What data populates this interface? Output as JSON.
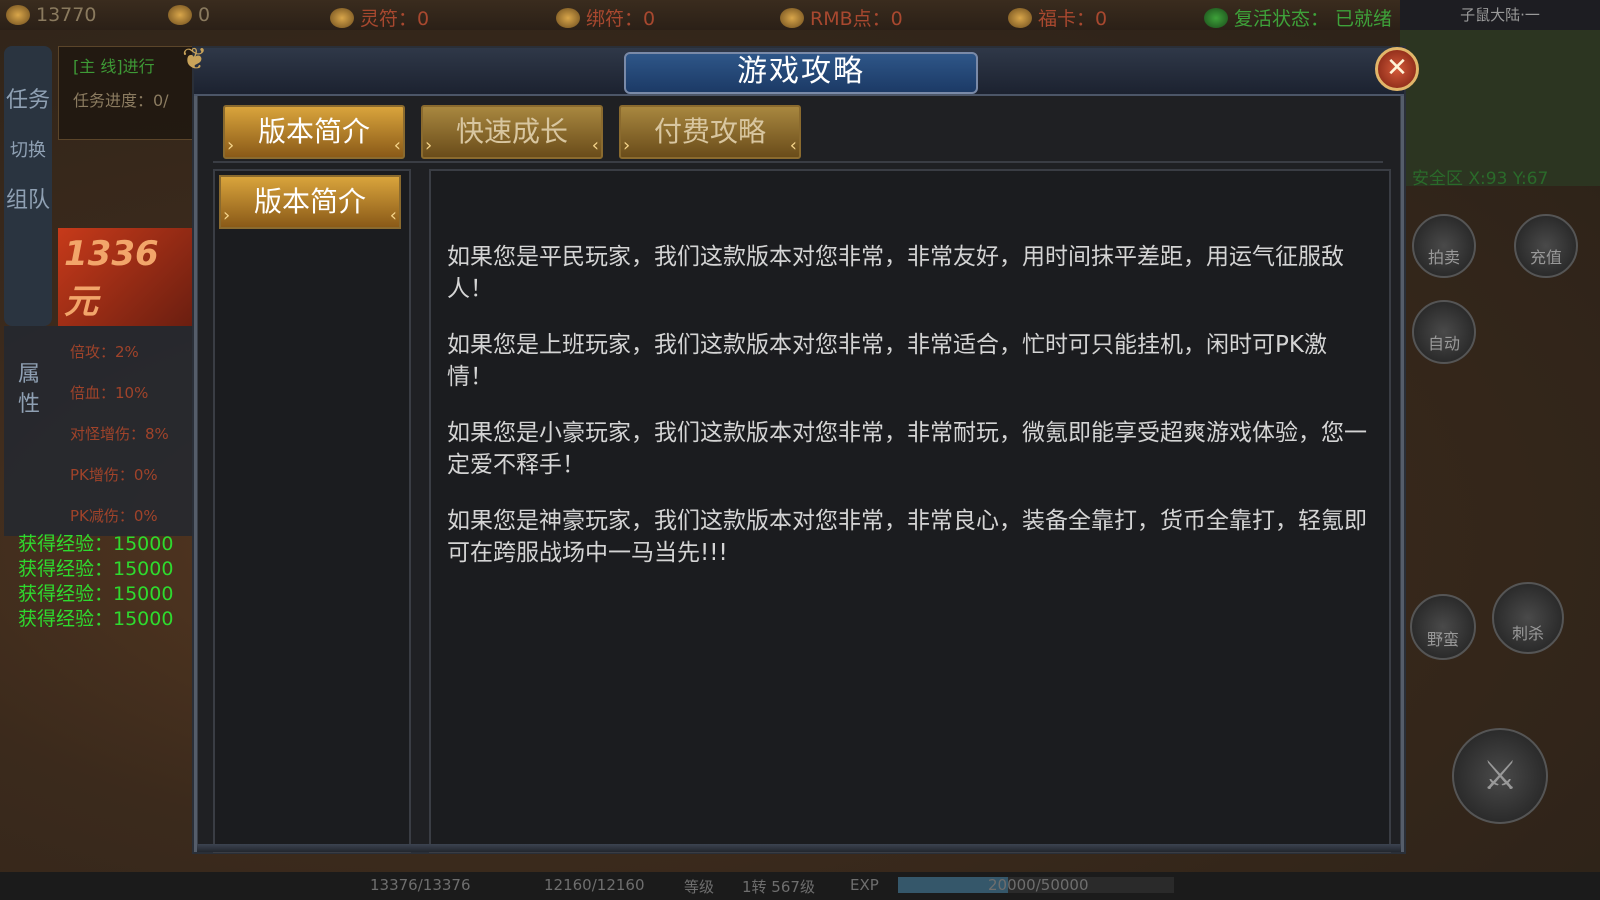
{
  "top_bar": {
    "gold": "13770",
    "ingot": "0",
    "lingfu": "灵符：0",
    "bangfu": "绑符：0",
    "rmb": "RMB点：0",
    "fuka": "福卡：0",
    "revive_label": "复活状态：",
    "revive_value": "已就绪",
    "map_name": "子鼠大陆·一"
  },
  "left_panel": {
    "tabs": [
      "任务",
      "切换",
      "组队"
    ],
    "quest_title": "[主 线]进行",
    "quest_progress": "任务进度：0/",
    "promo_text": "1336元",
    "attr_label": "属性",
    "attrs": [
      "倍攻：2%",
      "倍血：10%",
      "对怪增伤：8%",
      "PK增伤：0%",
      "PK减伤：0%"
    ],
    "exp_log": [
      "获得经验：15000",
      "获得经验：15000",
      "获得经验：15000",
      "获得经验：15000"
    ]
  },
  "right_panel": {
    "safe_zone": "安全区  X:93 Y:67",
    "skills": [
      "拍卖",
      "充值",
      "自动",
      "野蛮",
      "刺杀"
    ]
  },
  "bottom_bar": {
    "hp": "13376/13376",
    "mp": "12160/12160",
    "level_label": "等级",
    "level_value": "1转 567级",
    "exp_label": "EXP",
    "exp_value": "20000/50000",
    "exp_fraction": 0.4
  },
  "dialog": {
    "title": "游戏攻略",
    "close_glyph": "✕",
    "tabs": [
      {
        "label": "版本简介",
        "active": true
      },
      {
        "label": "快速成长",
        "active": false
      },
      {
        "label": "付费攻略",
        "active": false
      }
    ],
    "sidebar_items": [
      "版本简介"
    ],
    "paragraphs": [
      "如果您是平民玩家，我们这款版本对您非常，非常友好，用时间抹平差距，用运气征服敌人！",
      "如果您是上班玩家，我们这款版本对您非常，非常适合，忙时可只能挂机，闲时可PK激情！",
      "如果您是小豪玩家，我们这款版本对您非常，非常耐玩，微氪即能享受超爽游戏体验，您一定爱不释手！",
      "如果您是神豪玩家，我们这款版本对您非常，非常良心，装备全靠打，货币全靠打，轻氪即可在跨服战场中一马当先!!!"
    ]
  }
}
